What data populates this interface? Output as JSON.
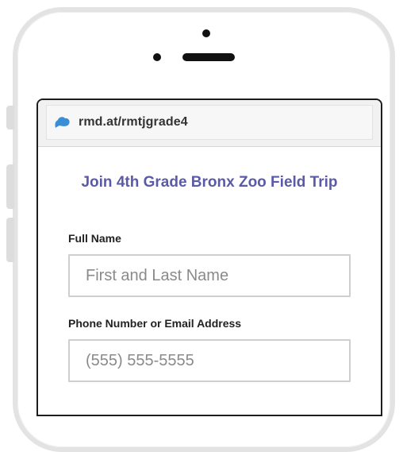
{
  "browser": {
    "url": "rmd.at/rmtjgrade4",
    "logo_icon": "cloud-logo-icon",
    "logo_color": "#3a8ed6"
  },
  "form": {
    "title": "Join 4th Grade Bronx Zoo Field Trip",
    "name_label": "Full Name",
    "name_placeholder": "First and Last Name",
    "contact_label": "Phone Number or Email Address",
    "contact_placeholder": "(555) 555-5555"
  },
  "colors": {
    "title": "#5a5aa8",
    "phone_frame": "#e3e3e3",
    "screen_border": "#1d1d1d"
  }
}
